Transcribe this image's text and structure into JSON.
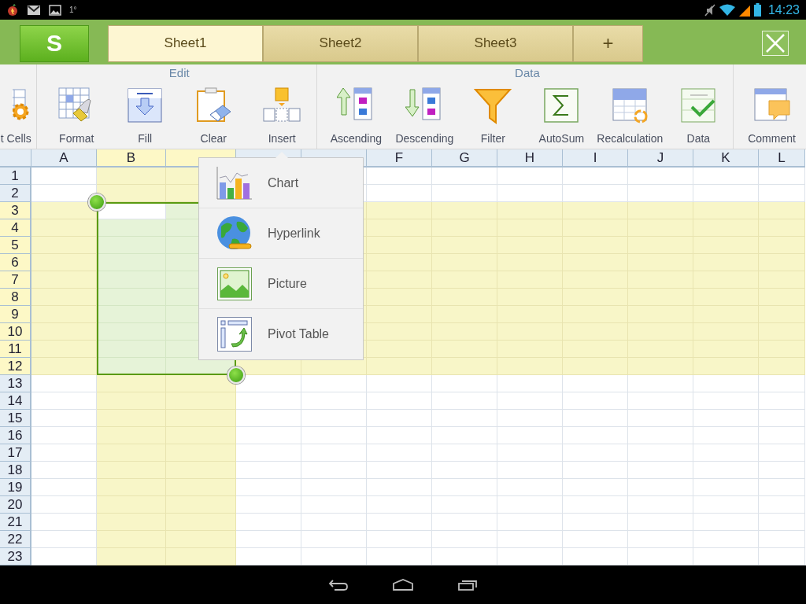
{
  "status_bar": {
    "indicator": "1°",
    "time": "14:23"
  },
  "app": {
    "logo": "S"
  },
  "tabs": [
    {
      "label": "Sheet1",
      "selected": true
    },
    {
      "label": "Sheet2",
      "selected": false
    },
    {
      "label": "Sheet3",
      "selected": false
    }
  ],
  "add_tab": "+",
  "ribbon": {
    "sections": [
      {
        "items": [
          {
            "kind": "cells",
            "label": "t Cells"
          }
        ]
      },
      {
        "title": "Edit",
        "items": [
          {
            "kind": "format",
            "label": "Format"
          },
          {
            "kind": "fill",
            "label": "Fill"
          },
          {
            "kind": "clear",
            "label": "Clear"
          },
          {
            "kind": "insert",
            "label": "Insert"
          }
        ]
      },
      {
        "title": "Data",
        "items": [
          {
            "kind": "ascending",
            "label": "Ascending"
          },
          {
            "kind": "descending",
            "label": "Descending"
          },
          {
            "kind": "filter",
            "label": "Filter"
          },
          {
            "kind": "autosum",
            "label": "AutoSum"
          },
          {
            "kind": "recalc",
            "label": "Recalculation"
          },
          {
            "kind": "validate",
            "label": "Data"
          }
        ]
      },
      {
        "items": [
          {
            "kind": "comment",
            "label": "Comment"
          }
        ]
      }
    ]
  },
  "sheet": {
    "columns": [
      {
        "label": "A",
        "selected": false
      },
      {
        "label": "B",
        "selected": true
      },
      {
        "selected": true
      },
      {
        "selected": false
      },
      {
        "selected": false
      },
      {
        "label": "F",
        "selected": false
      },
      {
        "label": "G",
        "selected": false
      },
      {
        "label": "H",
        "selected": false
      },
      {
        "label": "I",
        "selected": false
      },
      {
        "label": "J",
        "selected": false
      },
      {
        "label": "K",
        "selected": false
      },
      {
        "label": "L",
        "selected": false
      }
    ],
    "rows": [
      {
        "label": "1",
        "selected": false
      },
      {
        "label": "2",
        "selected": false
      },
      {
        "label": "3",
        "selected": true
      },
      {
        "label": "4",
        "selected": true
      },
      {
        "label": "5",
        "selected": true
      },
      {
        "label": "6",
        "selected": true
      },
      {
        "label": "7",
        "selected": true
      },
      {
        "label": "8",
        "selected": true
      },
      {
        "label": "9",
        "selected": true
      },
      {
        "label": "10",
        "selected": true
      },
      {
        "label": "11",
        "selected": true
      },
      {
        "label": "12",
        "selected": true
      },
      {
        "label": "13",
        "selected": false
      },
      {
        "label": "14",
        "selected": false
      },
      {
        "label": "15",
        "selected": false
      },
      {
        "label": "16",
        "selected": false
      },
      {
        "label": "17",
        "selected": false
      },
      {
        "label": "18",
        "selected": false
      },
      {
        "label": "19",
        "selected": false
      },
      {
        "label": "20",
        "selected": false
      },
      {
        "label": "21",
        "selected": false
      },
      {
        "label": "22",
        "selected": false
      },
      {
        "label": "23",
        "selected": false
      }
    ]
  },
  "insert_menu": {
    "items": [
      {
        "kind": "chart",
        "label": "Chart"
      },
      {
        "kind": "hyperlink",
        "label": "Hyperlink"
      },
      {
        "kind": "picture",
        "label": "Picture"
      },
      {
        "kind": "pivot",
        "label": "Pivot Table"
      }
    ]
  }
}
